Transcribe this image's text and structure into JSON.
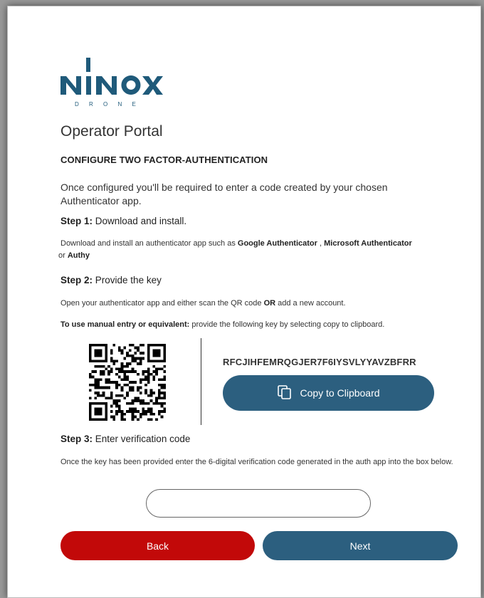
{
  "brand": {
    "logo_text": "NINOX",
    "logo_sub": "D R O N E",
    "color": "#1f5a7a"
  },
  "page": {
    "portal_title": "Operator Portal",
    "heading": "CONFIGURE TWO FACTOR-AUTHENTICATION",
    "intro": "Once configured you'll be required to enter a code created by your chosen Authenticator app."
  },
  "step1": {
    "label": "Step 1:",
    "title": "Download and install.",
    "desc_prefix": "Download and install an authenticator app such as ",
    "app1": "Google Authenticator",
    "sep1": " , ",
    "app2": "Microsoft Authenticator",
    "sep2": " or ",
    "app3": "Authy"
  },
  "step2": {
    "label": "Step 2:",
    "title": "Provide the key",
    "desc_prefix": "Open your authenticator app and either scan the QR code ",
    "desc_or": "OR",
    "desc_suffix": " add a new account.",
    "manual_label": "To use manual entry or equivalent:",
    "manual_text": " provide the following key by selecting copy to clipboard.",
    "key": "RFCJIHFEMRQGJER7F6IYSVLYYAVZBFRR",
    "copy_label": "Copy to Clipboard",
    "copy_icon": "copy-icon"
  },
  "step3": {
    "label": "Step 3:",
    "title": "Enter verification code",
    "desc": "Once the key has been provided enter the 6-digital verification code generated in the auth app into the box below.",
    "input_value": "",
    "input_placeholder": ""
  },
  "actions": {
    "back_label": "Back",
    "next_label": "Next",
    "back_color": "#c20909",
    "next_color": "#2c5f7f"
  }
}
